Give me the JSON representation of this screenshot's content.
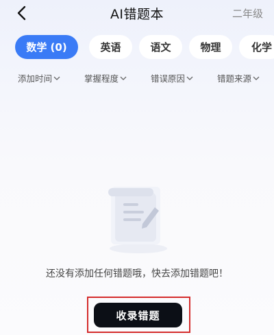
{
  "header": {
    "title": "AI错题本",
    "grade": "二年级"
  },
  "tabs": [
    {
      "label": "数学 (0)",
      "active": true
    },
    {
      "label": "英语",
      "active": false
    },
    {
      "label": "语文",
      "active": false
    },
    {
      "label": "物理",
      "active": false
    },
    {
      "label": "化学",
      "active": false
    }
  ],
  "filters": [
    {
      "label": "添加时间"
    },
    {
      "label": "掌握程度"
    },
    {
      "label": "错误原因"
    },
    {
      "label": "错题来源"
    }
  ],
  "empty_state": {
    "message": "还没有添加任何错题哦，快去添加错题吧！",
    "icon": "document-pencil-icon"
  },
  "cta": {
    "label": "收录错题"
  },
  "colors": {
    "accent": "#3a7bf6",
    "cta_background": "#0c0f16",
    "highlight_border": "#d42a2a"
  }
}
